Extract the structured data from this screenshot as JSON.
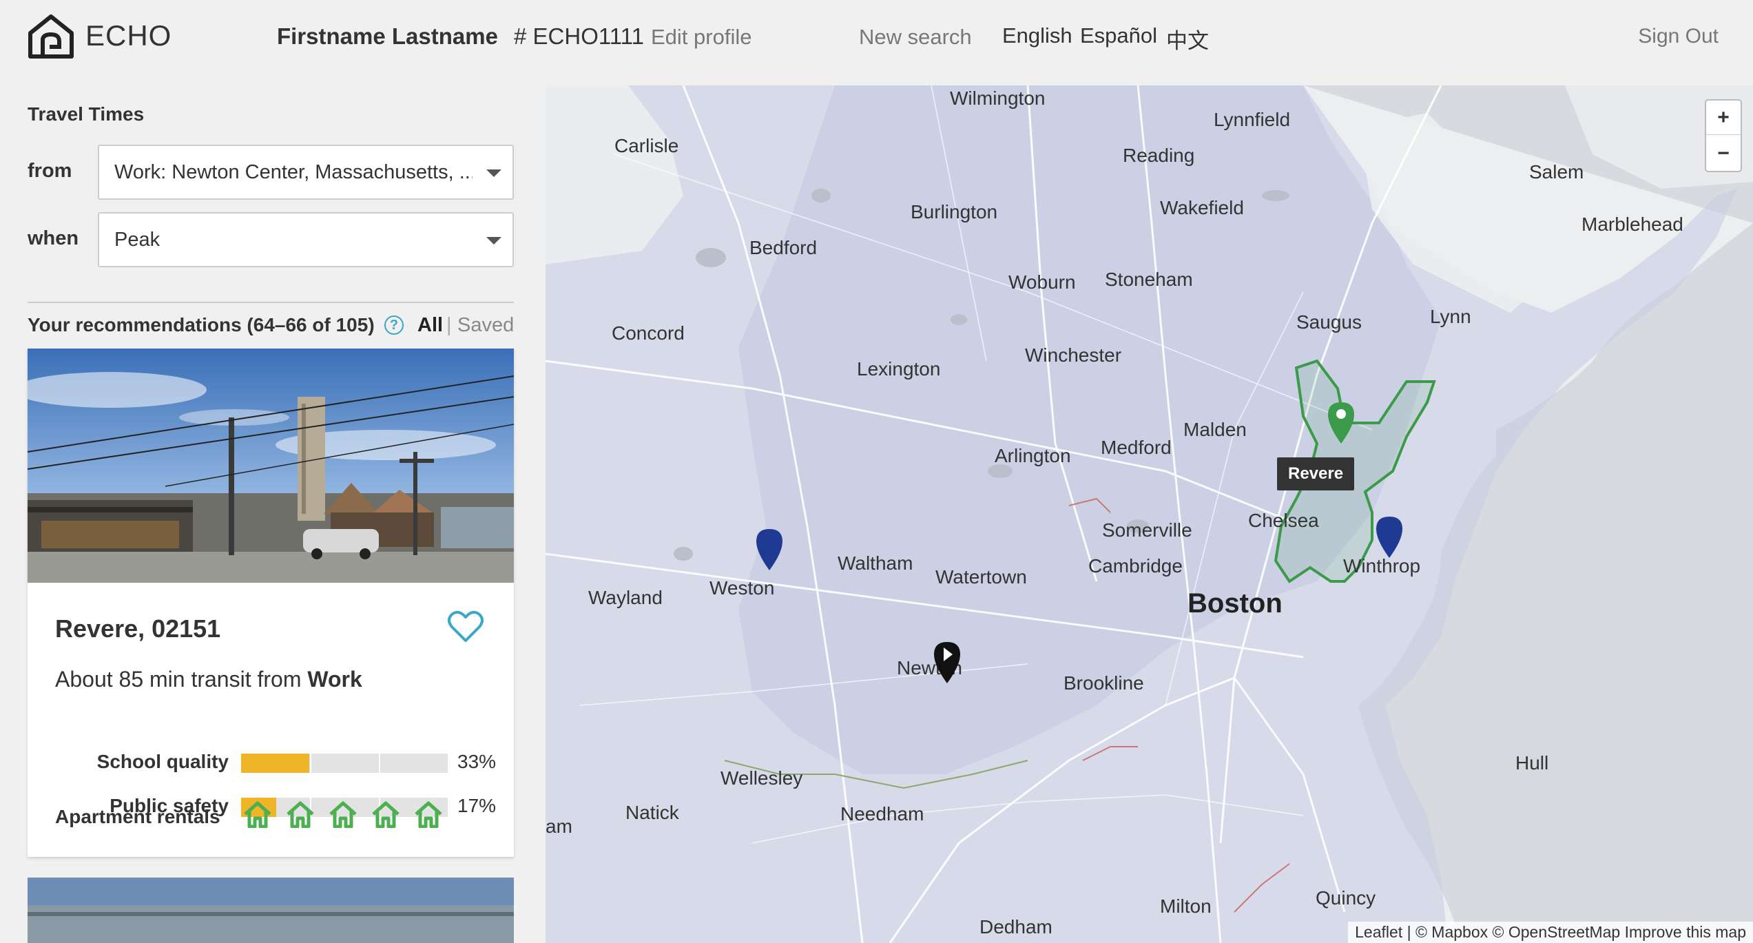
{
  "header": {
    "brand": "ECHO",
    "user_name": "Firstname Lastname",
    "user_id": "# ECHO1111",
    "edit_profile": "Edit profile",
    "new_search": "New search",
    "languages": [
      "English",
      "Español",
      "中文"
    ],
    "sign_out": "Sign Out"
  },
  "sidebar": {
    "travel_times_title": "Travel Times",
    "from_label": "from",
    "from_value": "Work: Newton Center, Massachusetts, ...",
    "when_label": "when",
    "when_value": "Peak",
    "recommendations_title": "Your recommendations (64–66 of 105)",
    "help_icon": "?",
    "filter_all": "All",
    "filter_sep": "|",
    "filter_saved": "Saved"
  },
  "card": {
    "title": "Revere, 02151",
    "transit_prefix": "About 85 min transit from",
    "transit_dest": "Work",
    "metrics": [
      {
        "label": "School quality",
        "value_text": "33%",
        "fraction": 0.33
      },
      {
        "label": "Public safety",
        "value_text": "17%",
        "fraction": 0.17
      }
    ],
    "rentals_label": "Apartment rentals",
    "rentals_count": 5,
    "accent_color": "#3aa7c7",
    "bar_color": "#f0b429",
    "house_color": "#4caf50"
  },
  "map": {
    "places": [
      {
        "name": "Wilmington"
      },
      {
        "name": "Lynnfield"
      },
      {
        "name": "Carlisle"
      },
      {
        "name": "Reading"
      },
      {
        "name": "Salem"
      },
      {
        "name": "Marblehead"
      },
      {
        "name": "Burlington"
      },
      {
        "name": "Wakefield"
      },
      {
        "name": "Bedford"
      },
      {
        "name": "Woburn"
      },
      {
        "name": "Stoneham"
      },
      {
        "name": "Saugus"
      },
      {
        "name": "Lynn"
      },
      {
        "name": "Concord"
      },
      {
        "name": "Lexington"
      },
      {
        "name": "Winchester"
      },
      {
        "name": "Malden"
      },
      {
        "name": "Arlington"
      },
      {
        "name": "Medford"
      },
      {
        "name": "Chelsea"
      },
      {
        "name": "Somerville"
      },
      {
        "name": "Cambridge"
      },
      {
        "name": "Winthrop"
      },
      {
        "name": "Boston"
      },
      {
        "name": "Waltham"
      },
      {
        "name": "Watertown"
      },
      {
        "name": "Weston"
      },
      {
        "name": "Wayland"
      },
      {
        "name": "Newton"
      },
      {
        "name": "Brookline"
      },
      {
        "name": "Wellesley"
      },
      {
        "name": "Natick"
      },
      {
        "name": "Needham"
      },
      {
        "name": "Hull"
      },
      {
        "name": "Milton"
      },
      {
        "name": "Quincy"
      },
      {
        "name": "Dedham"
      },
      {
        "name": "am"
      }
    ],
    "tooltip": "Revere",
    "zoom_in": "+",
    "zoom_out": "−",
    "attribution": "Leaflet | © Mapbox © OpenStreetMap Improve this map",
    "highlight_color": "#3b9b4a",
    "marker_color": "#1f3a93"
  }
}
